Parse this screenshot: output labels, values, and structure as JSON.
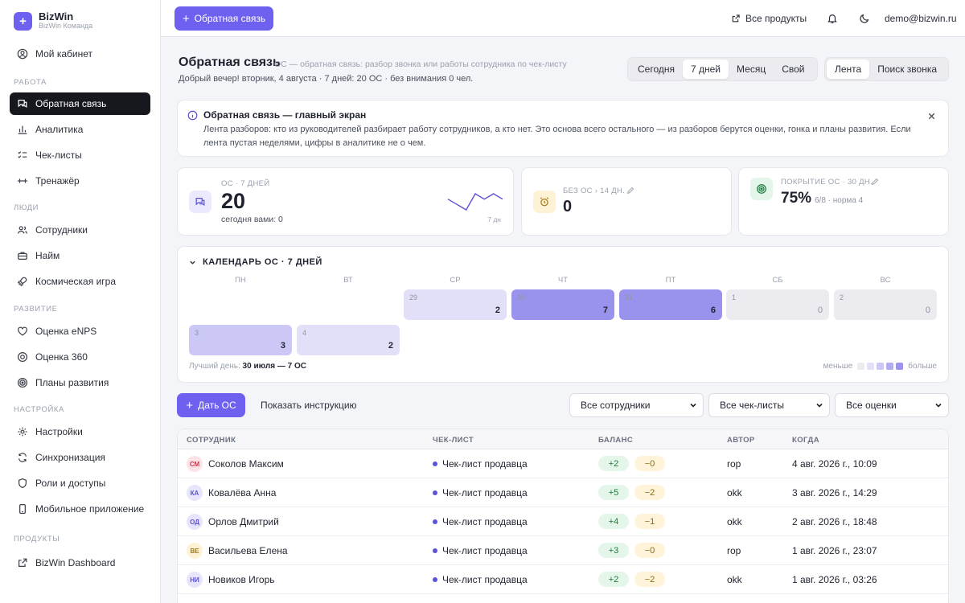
{
  "sidebar": {
    "brand_name": "BizWin",
    "brand_sub": "BizWin Команда",
    "brand_logo": "+",
    "cabinet": "Мой кабинет",
    "sections": {
      "work": "РАБОТА",
      "people": "ЛЮДИ",
      "dev": "РАЗВИТИЕ",
      "settings": "НАСТРОЙКА",
      "products": "ПРОДУКТЫ"
    },
    "items": {
      "feedback": "Обратная связь",
      "analytics": "Аналитика",
      "checklists": "Чек-листы",
      "trainer": "Тренажёр",
      "employees": "Сотрудники",
      "hiring": "Найм",
      "space": "Космическая игра",
      "enps": "Оценка eNPS",
      "r360": "Оценка 360",
      "plans": "Планы развития",
      "settings": "Настройки",
      "sync": "Синхронизация",
      "roles": "Роли и доступы",
      "mobile": "Мобильное приложение",
      "dashboard": "BizWin Dashboard"
    }
  },
  "topbar": {
    "feedback_button": "Обратная связь",
    "all_products": "Все продукты",
    "email": "demo@bizwin.ru"
  },
  "header": {
    "title": "Обратная связь",
    "desc": "ОС — обратная связь: разбор звонка или работы сотрудника по чек-листу",
    "greeting": "Добрый вечер! вторник, 4 августа · 7 дней: 20 ОС · без внимания 0 чел.",
    "periods": [
      "Сегодня",
      "7 дней",
      "Месяц",
      "Свой"
    ],
    "active_period": "7 дней",
    "views": [
      "Лента",
      "Поиск звонка"
    ],
    "active_view": "Лента"
  },
  "info": {
    "title": "Обратная связь — главный экран",
    "text": "Лента разборов: кто из руководителей разбирает работу сотрудников, а кто нет. Это основа всего остального — из разборов берутся оценки, гонка и планы развития. Если лента пустая неделями, цифры в аналитике не о чем."
  },
  "kpis": {
    "os": {
      "label": "ОС · 7 ДНЕЙ",
      "value": "20",
      "sub": "сегодня вами: 0",
      "spark_label": "7 дн",
      "spark": [
        3,
        2,
        1,
        4,
        3,
        4,
        3
      ]
    },
    "no_os": {
      "label": "БЕЗ ОС › 14 ДН.",
      "value": "0"
    },
    "coverage": {
      "label": "ПОКРЫТИЕ ОС · 30 ДН.",
      "value": "75%",
      "sub": "6/8 · норма 4"
    }
  },
  "calendar": {
    "title": "КАЛЕНДАРЬ ОС · 7 ДНЕЙ",
    "dows": [
      "ПН",
      "ВТ",
      "СР",
      "ЧТ",
      "ПТ",
      "СБ",
      "ВС"
    ],
    "week1": [
      {
        "day": "29",
        "value": "2"
      },
      {
        "day": "30",
        "value": "7"
      },
      {
        "day": "31",
        "value": "6"
      },
      {
        "day": "1",
        "value": "0"
      },
      {
        "day": "2",
        "value": "0"
      }
    ],
    "week2": [
      {
        "day": "3",
        "value": "3"
      },
      {
        "day": "4",
        "value": "2"
      }
    ],
    "best_label": "Лучший день:",
    "best_value": "30 июля — 7 ОС",
    "legend_less": "меньше",
    "legend_more": "больше",
    "colors": [
      "#ececf0",
      "#e1e0f8",
      "#cbc8f5",
      "#b1acf1",
      "#9a93ee"
    ]
  },
  "actions": {
    "give_button": "Дать ОС",
    "show_instruction": "Показать инструкцию",
    "filter_employees": "Все сотрудники",
    "filter_checklists": "Все чек-листы",
    "filter_scores": "Все оценки"
  },
  "table": {
    "headers": [
      "СОТРУДНИК",
      "ЧЕК-ЛИСТ",
      "БАЛАНС",
      "АВТОР",
      "КОГДА"
    ],
    "rows": [
      {
        "initials": "СМ",
        "name": "Соколов Максим",
        "checklist": "Чек-лист продавца",
        "plus": "+2",
        "minus": "−0",
        "author": "rop",
        "when": "4 авг. 2026 г., 10:09",
        "av_bg": "#fde3e6",
        "av_fg": "#c43a4d"
      },
      {
        "initials": "КА",
        "name": "Ковалёва Анна",
        "checklist": "Чек-лист продавца",
        "plus": "+5",
        "minus": "−2",
        "author": "okk",
        "when": "3 авг. 2026 г., 14:29",
        "av_bg": "#e6e5fb",
        "av_fg": "#5b52d6"
      },
      {
        "initials": "ОД",
        "name": "Орлов Дмитрий",
        "checklist": "Чек-лист продавца",
        "plus": "+4",
        "minus": "−1",
        "author": "okk",
        "when": "2 авг. 2026 г., 18:48",
        "av_bg": "#e6e5fb",
        "av_fg": "#5b52d6"
      },
      {
        "initials": "ВЕ",
        "name": "Васильева Елена",
        "checklist": "Чек-лист продавца",
        "plus": "+3",
        "minus": "−0",
        "author": "rop",
        "when": "1 авг. 2026 г., 23:07",
        "av_bg": "#fdf1d6",
        "av_fg": "#a57a12"
      },
      {
        "initials": "НИ",
        "name": "Новиков Игорь",
        "checklist": "Чек-лист продавца",
        "plus": "+2",
        "minus": "−2",
        "author": "okk",
        "when": "1 авг. 2026 г., 03:26",
        "av_bg": "#e6e5fb",
        "av_fg": "#5b52d6"
      }
    ]
  }
}
